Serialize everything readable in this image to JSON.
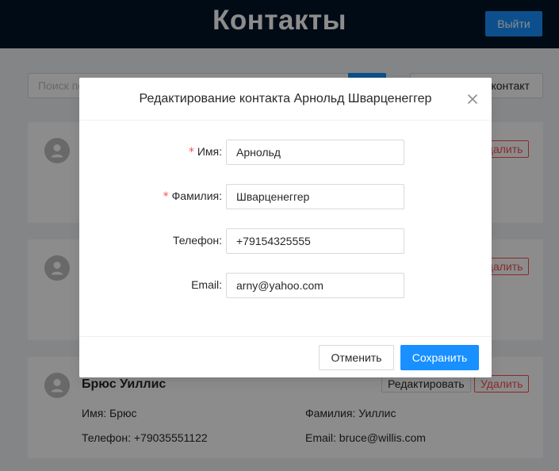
{
  "header": {
    "title": "Контакты",
    "logout_label": "Выйти"
  },
  "toolbar": {
    "search_placeholder": "Поиск по",
    "add_label": "контакт"
  },
  "cards": [
    {
      "actions": {
        "delete_label": "Удалить"
      }
    },
    {
      "actions": {
        "delete_label": "Удалить"
      }
    },
    {
      "name": "Брюс Уиллис",
      "actions": {
        "edit_label": "Редактировать",
        "delete_label": "Удалить"
      },
      "first_name_text": "Имя: Брюс",
      "last_name_text": "Фамилия: Уиллис",
      "phone_text": "Телефон: +79035551122",
      "email_text": "Email: bruce@willis.com"
    }
  ],
  "modal": {
    "title": "Редактирование контакта Арнольд Шварценеггер",
    "fields": [
      {
        "label": "Имя:",
        "required_mark": "*",
        "value": "Арнольд"
      },
      {
        "label": "Фамилия:",
        "required_mark": "*",
        "value": "Шварценеггер"
      },
      {
        "label": "Телефон:",
        "value": "+79154325555"
      },
      {
        "label": "Email:",
        "value": "arny@yahoo.com"
      }
    ],
    "cancel_label": "Отменить",
    "save_label": "Сохранить"
  },
  "colors": {
    "header_bg": "#001529",
    "primary": "#1890ff",
    "danger": "#ff4d4f",
    "page_bg": "#f0f2f5"
  },
  "icons": [
    "search-icon",
    "user-avatar-icon",
    "close-icon"
  ]
}
